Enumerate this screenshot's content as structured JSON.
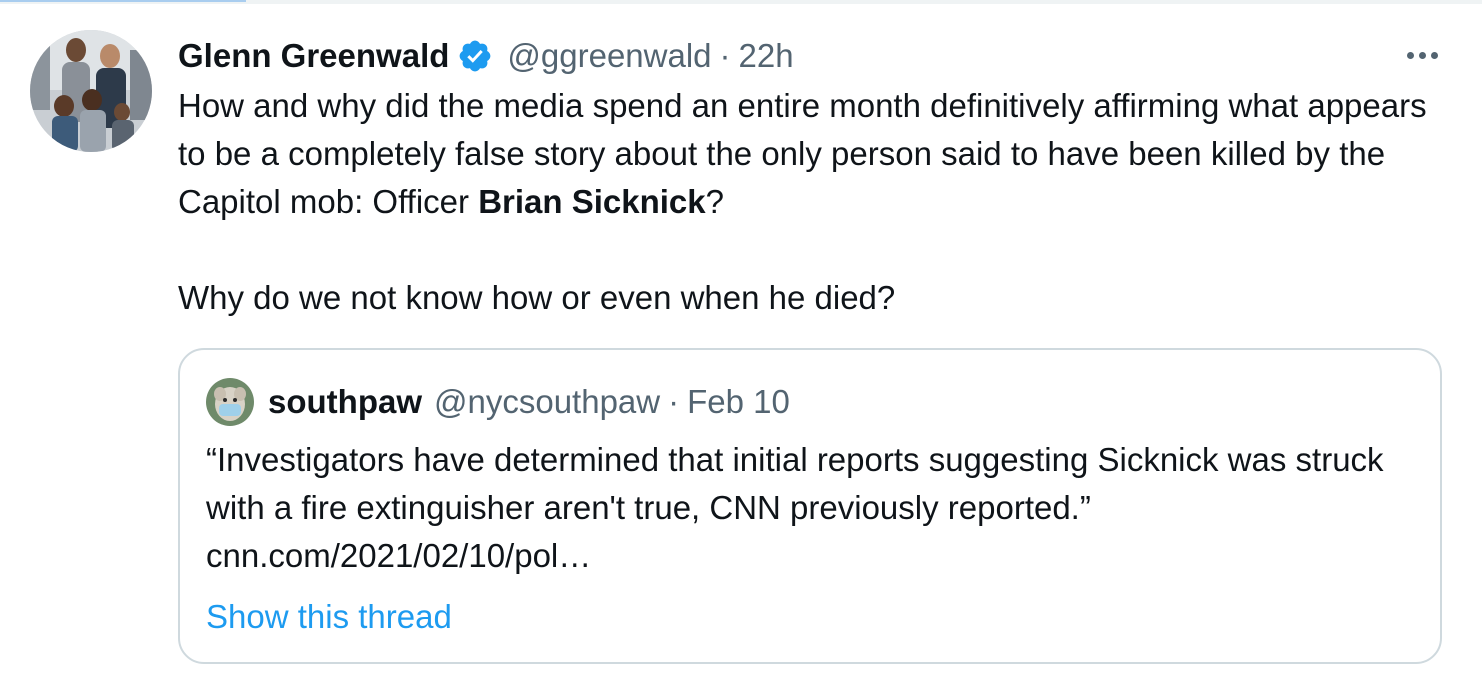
{
  "tweet": {
    "author_name": "Glenn Greenwald",
    "verified": true,
    "handle": "@ggreenwald",
    "separator": "·",
    "time": "22h",
    "text_before": "How and why did the media spend an entire month definitively affirming what appears to be a completely false story about the only person said to have been killed by the Capitol mob: Officer ",
    "text_bold": "Brian Sicknick",
    "text_after": "?",
    "text_second_paragraph": "Why do we not know how or even when he died?",
    "more_icon": "more-horizontal-icon"
  },
  "quote": {
    "author_name": "southpaw",
    "handle": "@nycsouthpaw",
    "separator": "·",
    "time": "Feb 10",
    "text": "“Investigators have determined that initial reports suggesting Sicknick was struck with a fire extinguisher aren't true, CNN previously reported.” cnn.com/2021/02/10/pol…",
    "show_thread_label": "Show this thread"
  },
  "colors": {
    "text_primary": "#0f1419",
    "text_secondary": "#536471",
    "link": "#1d9bf0",
    "verified_badge": "#1d9bf0",
    "quote_border": "#cfd9de"
  }
}
